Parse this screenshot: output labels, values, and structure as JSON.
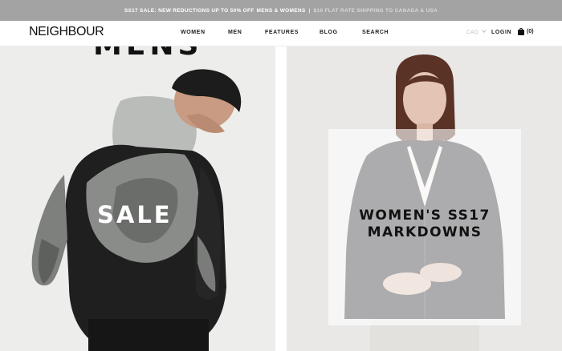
{
  "promo": {
    "text_a": "SS17 SALE: NEW REDUCTIONS UP TO 50% OFF",
    "link_a": "MENS & WOMENS",
    "separator": "|",
    "text_b": "$10 FLAT RATE SHIPPING TO CANADA & USA"
  },
  "header": {
    "logo": "NEIGHBOUR",
    "nav": [
      "WOMEN",
      "MEN",
      "FEATURES",
      "BLOG",
      "SEARCH"
    ],
    "currency": "CAD",
    "login": "LOGIN",
    "cart_count": "(0)"
  },
  "hero": {
    "left": {
      "heading": "MENS",
      "label": "SALE"
    },
    "right": {
      "label": "WOMEN'S SS17\nMARKDOWNS"
    }
  },
  "colors": {
    "promo_bg": "#a3a3a3",
    "panel_bg": "#ededeb",
    "text": "#111111"
  },
  "icons": {
    "cart": "shopping-bag-icon",
    "currency_toggle": "chevron-down-icon"
  }
}
